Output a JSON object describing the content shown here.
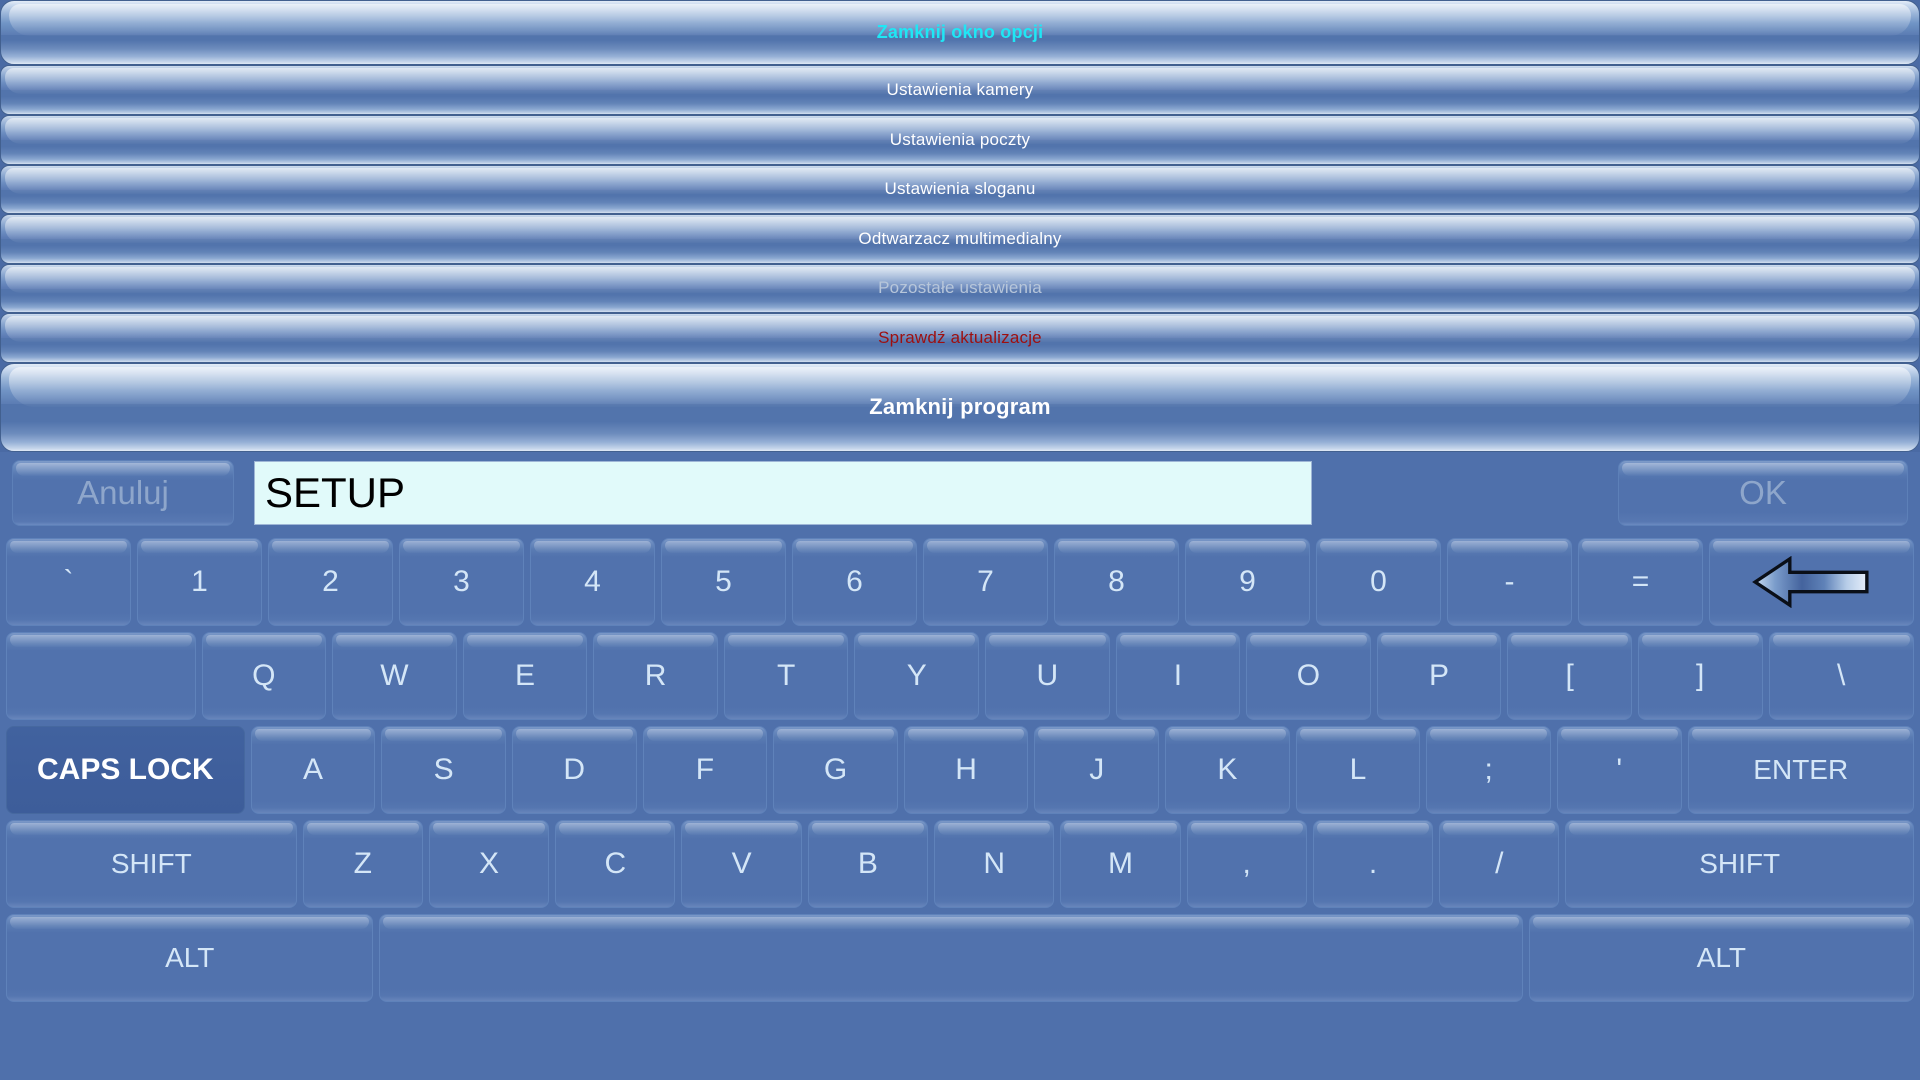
{
  "menu": {
    "items": [
      {
        "label": "Zamknij okno opcji",
        "color": "#1fe7f5",
        "style": "big"
      },
      {
        "label": "Ustawienia kamery",
        "color": "#ffffff",
        "style": "std"
      },
      {
        "label": "Ustawienia poczty",
        "color": "#ffffff",
        "style": "std"
      },
      {
        "label": "Ustawienia sloganu",
        "color": "#ffffff",
        "style": "std"
      },
      {
        "label": "Odtwarzacz multimedialny",
        "color": "#ffffff",
        "style": "std"
      },
      {
        "label": "Pozostałe ustawienia",
        "color": "#b7c6da",
        "style": "std"
      },
      {
        "label": "Sprawdź aktualizacje",
        "color": "#9e0f0f",
        "style": "std"
      },
      {
        "label": "Zamknij program",
        "color": "#ffffff",
        "style": "bigbottom"
      }
    ]
  },
  "input_bar": {
    "cancel_label": "Anuluj",
    "ok_label": "OK",
    "text_value": "SETUP",
    "text_placeholder": ""
  },
  "keyboard": {
    "rows": [
      {
        "name": "number-row",
        "keys": [
          {
            "label": "`",
            "name": "key-backtick",
            "flex": 1
          },
          {
            "label": "1",
            "name": "key-1",
            "flex": 1
          },
          {
            "label": "2",
            "name": "key-2",
            "flex": 1
          },
          {
            "label": "3",
            "name": "key-3",
            "flex": 1
          },
          {
            "label": "4",
            "name": "key-4",
            "flex": 1
          },
          {
            "label": "5",
            "name": "key-5",
            "flex": 1
          },
          {
            "label": "6",
            "name": "key-6",
            "flex": 1
          },
          {
            "label": "7",
            "name": "key-7",
            "flex": 1
          },
          {
            "label": "8",
            "name": "key-8",
            "flex": 1
          },
          {
            "label": "9",
            "name": "key-9",
            "flex": 1
          },
          {
            "label": "0",
            "name": "key-0",
            "flex": 1
          },
          {
            "label": "-",
            "name": "key-minus",
            "flex": 1
          },
          {
            "label": "=",
            "name": "key-equals",
            "flex": 1
          },
          {
            "label": "",
            "name": "key-backspace",
            "icon": "backspace-arrow-icon",
            "flex": 1.65
          }
        ]
      },
      {
        "name": "qwerty-row",
        "keys": [
          {
            "label": "",
            "name": "key-tab",
            "flex": 1.53
          },
          {
            "label": "Q",
            "name": "key-q",
            "flex": 1
          },
          {
            "label": "W",
            "name": "key-w",
            "flex": 1
          },
          {
            "label": "E",
            "name": "key-e",
            "flex": 1
          },
          {
            "label": "R",
            "name": "key-r",
            "flex": 1
          },
          {
            "label": "T",
            "name": "key-t",
            "flex": 1
          },
          {
            "label": "Y",
            "name": "key-y",
            "flex": 1
          },
          {
            "label": "U",
            "name": "key-u",
            "flex": 1
          },
          {
            "label": "I",
            "name": "key-i",
            "flex": 1
          },
          {
            "label": "O",
            "name": "key-o",
            "flex": 1
          },
          {
            "label": "P",
            "name": "key-p",
            "flex": 1
          },
          {
            "label": "[",
            "name": "key-bracket-left",
            "flex": 1
          },
          {
            "label": "]",
            "name": "key-bracket-right",
            "flex": 1
          },
          {
            "label": "\\",
            "name": "key-backslash",
            "flex": 1.17
          }
        ]
      },
      {
        "name": "home-row",
        "keys": [
          {
            "label": "CAPS LOCK",
            "name": "key-caps-lock",
            "flex": 1.93,
            "active": true
          },
          {
            "label": "A",
            "name": "key-a",
            "flex": 1
          },
          {
            "label": "S",
            "name": "key-s",
            "flex": 1
          },
          {
            "label": "D",
            "name": "key-d",
            "flex": 1
          },
          {
            "label": "F",
            "name": "key-f",
            "flex": 1
          },
          {
            "label": "G",
            "name": "key-g",
            "flex": 1
          },
          {
            "label": "H",
            "name": "key-h",
            "flex": 1
          },
          {
            "label": "J",
            "name": "key-j",
            "flex": 1
          },
          {
            "label": "K",
            "name": "key-k",
            "flex": 1
          },
          {
            "label": "L",
            "name": "key-l",
            "flex": 1
          },
          {
            "label": ";",
            "name": "key-semicolon",
            "flex": 1
          },
          {
            "label": "'",
            "name": "key-apostrophe",
            "flex": 1
          },
          {
            "label": "ENTER",
            "name": "key-enter",
            "flex": 1.83
          }
        ]
      },
      {
        "name": "shift-row",
        "keys": [
          {
            "label": "SHIFT",
            "name": "key-shift-left",
            "flex": 2.44
          },
          {
            "label": "Z",
            "name": "key-z",
            "flex": 1
          },
          {
            "label": "X",
            "name": "key-x",
            "flex": 1
          },
          {
            "label": "C",
            "name": "key-c",
            "flex": 1
          },
          {
            "label": "V",
            "name": "key-v",
            "flex": 1
          },
          {
            "label": "B",
            "name": "key-b",
            "flex": 1
          },
          {
            "label": "N",
            "name": "key-n",
            "flex": 1
          },
          {
            "label": "M",
            "name": "key-m",
            "flex": 1
          },
          {
            "label": ",",
            "name": "key-comma",
            "flex": 1
          },
          {
            "label": ".",
            "name": "key-period",
            "flex": 1
          },
          {
            "label": "/",
            "name": "key-slash",
            "flex": 1
          },
          {
            "label": "SHIFT",
            "name": "key-shift-right",
            "flex": 2.93
          }
        ]
      },
      {
        "name": "space-row",
        "keys": [
          {
            "label": "ALT",
            "name": "key-alt-left",
            "flex": 2.44
          },
          {
            "label": "",
            "name": "key-space",
            "flex": 7.62
          },
          {
            "label": "ALT",
            "name": "key-alt-right",
            "flex": 2.56
          }
        ]
      }
    ]
  },
  "colors": {
    "background": "#4f70ab",
    "key_face": "#5172ad",
    "key_text": "#d4e6f7",
    "active_key_face": "#3f5f9c",
    "input_field": "#e1fafa",
    "disabled_text": "#8ea6cb"
  }
}
